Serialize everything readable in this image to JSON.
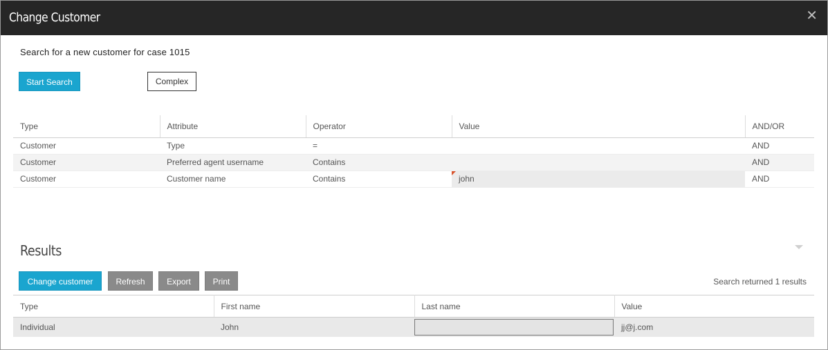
{
  "dialog": {
    "title": "Change Customer",
    "close_icon": "close-icon"
  },
  "search": {
    "subtitle": "Search for a new customer for case 1015",
    "start_search_label": "Start Search",
    "complex_label": "Complex"
  },
  "criteria": {
    "columns": [
      "Type",
      "Attribute",
      "Operator",
      "Value",
      "AND/OR"
    ],
    "rows": [
      {
        "type": "Customer",
        "attribute": "Type",
        "operator": "=",
        "value": "",
        "andor": "AND"
      },
      {
        "type": "Customer",
        "attribute": "Preferred agent username",
        "operator": "Contains",
        "value": "",
        "andor": "AND"
      },
      {
        "type": "Customer",
        "attribute": "Customer name",
        "operator": "Contains",
        "value": "john",
        "andor": "AND"
      }
    ]
  },
  "results": {
    "title": "Results",
    "change_customer_label": "Change customer",
    "refresh_label": "Refresh",
    "export_label": "Export",
    "print_label": "Print",
    "count_text": "Search returned 1 results",
    "columns": [
      "Type",
      "First name",
      "Last name",
      "Value"
    ],
    "rows": [
      {
        "type": "Individual",
        "first_name": "John",
        "last_name": "",
        "value": "jj@j.com"
      }
    ]
  },
  "colors": {
    "titlebar": "#262626",
    "primary_button": "#1aa5cf",
    "grey_button": "#8a8a8a",
    "required_marker": "#d9532c"
  }
}
